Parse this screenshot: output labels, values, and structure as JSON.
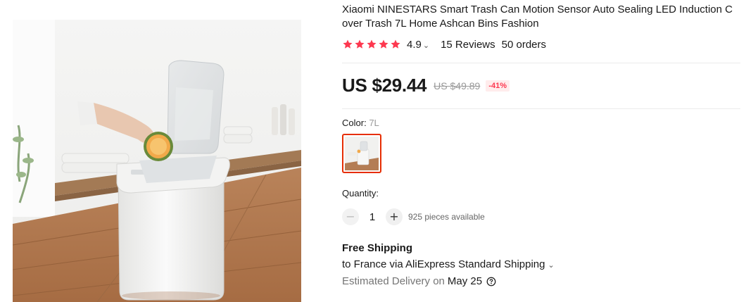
{
  "product": {
    "title": "Xiaomi NINESTARS Smart Trash Can Motion Sensor Auto Sealing LED Induction Cover Trash 7L Home Ashcan Bins Fashion",
    "image_icon": "product-photo-trash-can"
  },
  "rating": {
    "stars": 5,
    "value": "4.9",
    "reviews": "15 Reviews",
    "orders": "50 orders",
    "star_color": "#fd384f"
  },
  "price": {
    "current": "US $29.44",
    "original": "US $49.89",
    "discount": "-41%",
    "discount_color": "#fd384f"
  },
  "color": {
    "label": "Color:",
    "selected": "7L",
    "selected_border_color": "#e62e04"
  },
  "quantity": {
    "label": "Quantity:",
    "value": "1",
    "minus": "−",
    "plus": "+",
    "available": "925 pieces available"
  },
  "shipping": {
    "title": "Free Shipping",
    "method": "to France via AliExpress Standard Shipping",
    "estimated_label": "Estimated Delivery on",
    "estimated_date": "May 25"
  }
}
